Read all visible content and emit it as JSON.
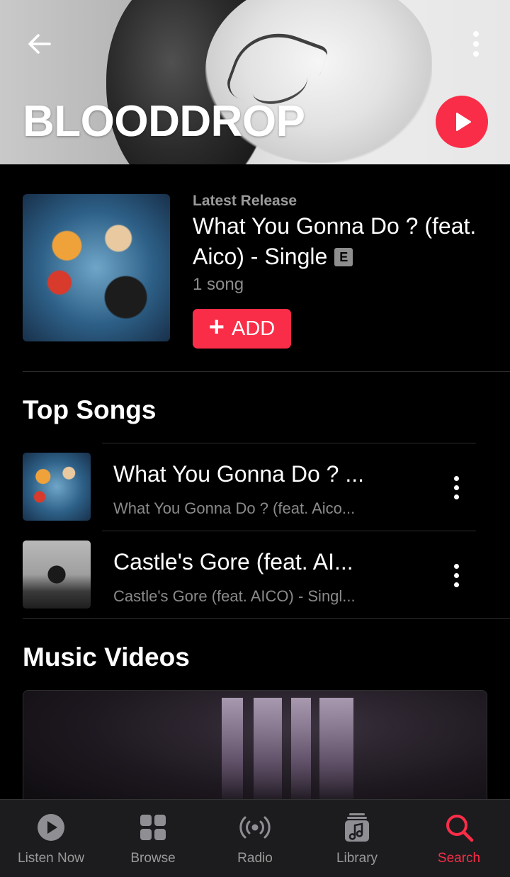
{
  "artist": {
    "name": "BLOODDROP"
  },
  "latest_release": {
    "label": "Latest Release",
    "title": "What You Gonna Do ? (feat. Aico) - Single",
    "explicit_badge": "E",
    "song_count": "1 song",
    "add_label": "ADD"
  },
  "top_songs": {
    "title": "Top Songs",
    "items": [
      {
        "title": "What You Gonna Do ? ...",
        "subtitle": "What You Gonna Do ? (feat. Aico..."
      },
      {
        "title": "Castle's Gore (feat. AI...",
        "subtitle": "Castle's Gore (feat. AICO) - Singl..."
      }
    ]
  },
  "music_videos": {
    "title": "Music Videos"
  },
  "tabbar": {
    "items": [
      {
        "label": "Listen Now",
        "icon": "play-circle-icon"
      },
      {
        "label": "Browse",
        "icon": "grid-icon"
      },
      {
        "label": "Radio",
        "icon": "radio-icon"
      },
      {
        "label": "Library",
        "icon": "library-icon"
      },
      {
        "label": "Search",
        "icon": "search-icon"
      }
    ],
    "active": "Search"
  },
  "colors": {
    "accent": "#fa2d48",
    "background": "#000000",
    "tabbar": "#1c1c1e",
    "secondary_text": "#8a8a8a"
  }
}
